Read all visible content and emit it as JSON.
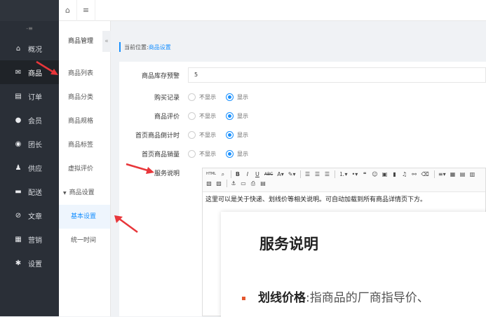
{
  "sidebar": {
    "toggle": "-≡",
    "items": [
      {
        "label": "概况",
        "icon": "home-icon",
        "active": false
      },
      {
        "label": "商品",
        "icon": "product-icon",
        "active": true
      },
      {
        "label": "订单",
        "icon": "order-icon",
        "active": false
      },
      {
        "label": "会员",
        "icon": "member-icon",
        "active": false
      },
      {
        "label": "团长",
        "icon": "leader-icon",
        "active": false
      },
      {
        "label": "供应",
        "icon": "supply-icon",
        "active": false
      },
      {
        "label": "配送",
        "icon": "delivery-icon",
        "active": false
      },
      {
        "label": "文章",
        "icon": "article-icon",
        "active": false
      },
      {
        "label": "营销",
        "icon": "marketing-icon",
        "active": false
      },
      {
        "label": "设置",
        "icon": "settings-icon",
        "active": false
      }
    ]
  },
  "submenu": {
    "title": "商品管理",
    "collapse": "«",
    "items": [
      "商品列表",
      "商品分类",
      "商品规格",
      "商品标签",
      "虚拟评价"
    ],
    "group": "商品设置",
    "group_items": [
      "基本设置",
      "统一时间"
    ]
  },
  "breadcrumb": {
    "prefix": "当前位置:",
    "current": "商品设置"
  },
  "form": {
    "stock_warning": {
      "label": "商品库存预警",
      "value": "5"
    },
    "radio_rows": [
      {
        "label": "购买记录",
        "off": "不显示",
        "on": "显示"
      },
      {
        "label": "商品评价",
        "off": "不显示",
        "on": "显示"
      },
      {
        "label": "首页商品倒计时",
        "off": "不显示",
        "on": "显示"
      },
      {
        "label": "首页商品销量",
        "off": "不显示",
        "on": "显示"
      }
    ],
    "service": {
      "label": "服务说明",
      "content": "这里可以是关于快递、划线价等相关说明。可自动加载到所有商品详情页下方。"
    }
  },
  "preview": {
    "heading": "服务说明",
    "item_bold": "划线价格",
    "item_text": ":指商品的厂商指导价、"
  },
  "colors": {
    "accent": "#1890ff",
    "sidebar_bg": "#2a2f37",
    "arrow": "#e8363a"
  }
}
